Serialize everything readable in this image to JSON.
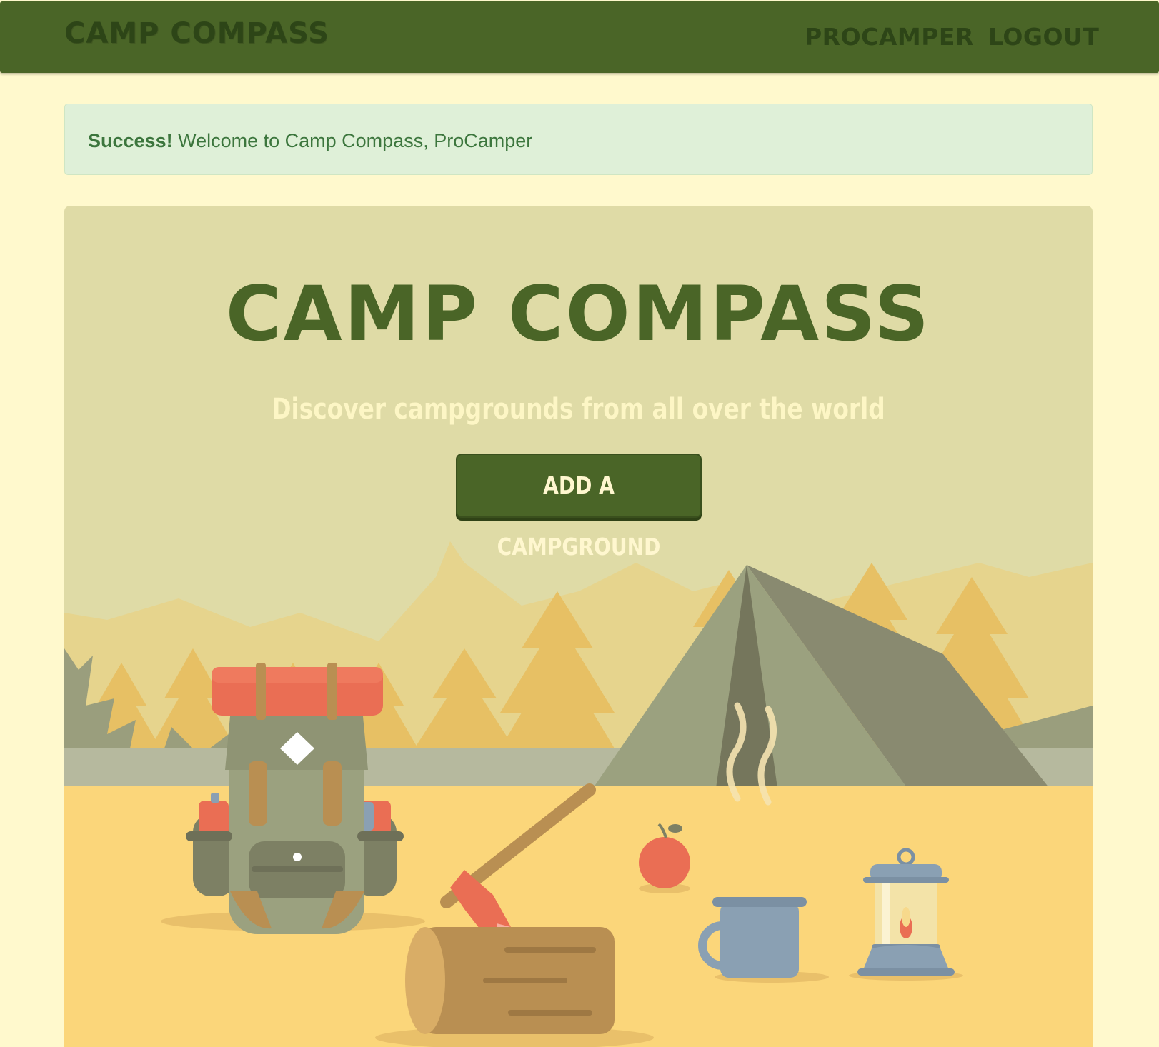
{
  "navbar": {
    "brand": "CAMP COMPASS",
    "links": [
      {
        "label": "PROCAMPER"
      },
      {
        "label": "LOGOUT"
      }
    ]
  },
  "alert": {
    "strong": "Success!",
    "message": " Welcome to Camp Compass, ProCamper"
  },
  "hero": {
    "title": "CAMP COMPASS",
    "subtitle": "Discover campgrounds from all over the world",
    "button_label": "ADD A CAMPGROUND"
  },
  "colors": {
    "navbar": "#4a6527",
    "page_background": "#fff9cd",
    "hero_background": "#dfdba6",
    "alert_background": "#dff0d8",
    "alert_text": "#3c763d",
    "ground": "#fbd67a"
  },
  "illustration": {
    "items": [
      "mountains",
      "pine-trees",
      "tent",
      "backpack",
      "axe",
      "log",
      "apple",
      "mug",
      "lantern"
    ]
  }
}
